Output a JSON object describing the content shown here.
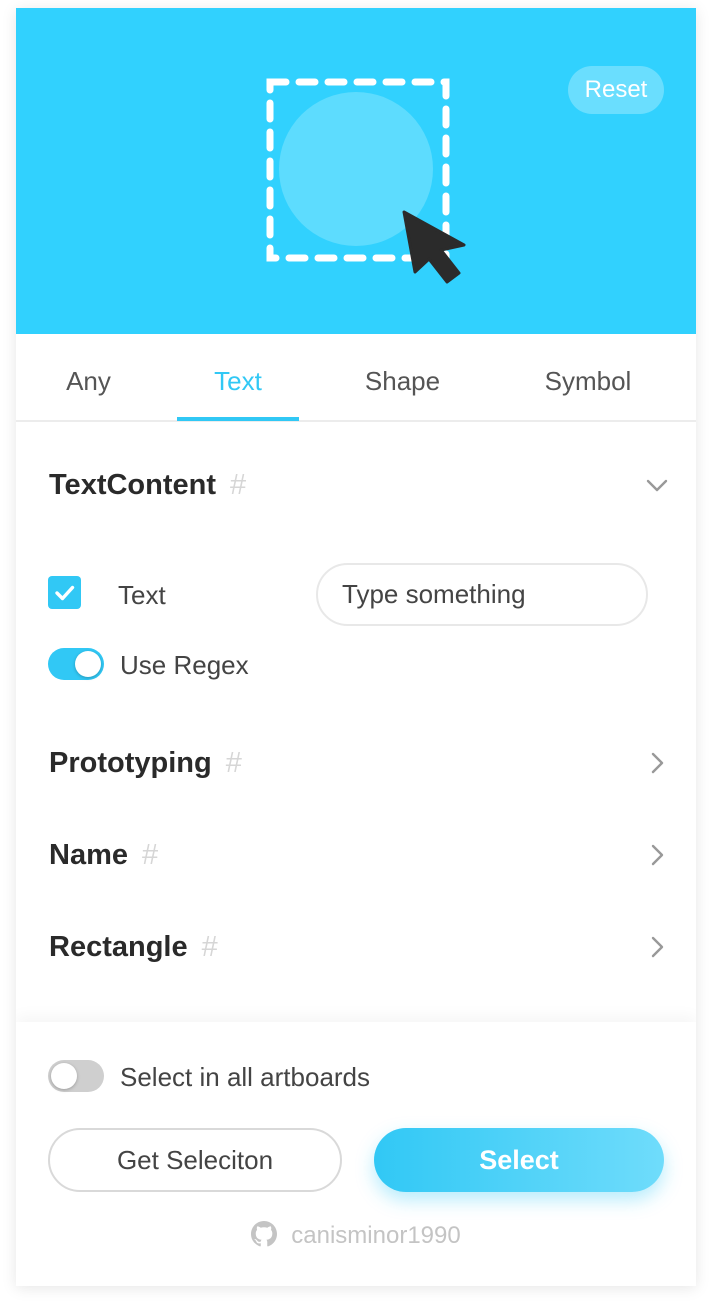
{
  "header": {
    "illustration": "select-shape-illustration",
    "reset_label": "Reset",
    "background_color": "#31d1fe"
  },
  "tabs": [
    {
      "label": "Any",
      "active": false
    },
    {
      "label": "Text",
      "active": true
    },
    {
      "label": "Shape",
      "active": false
    },
    {
      "label": "Symbol",
      "active": false
    }
  ],
  "sections": {
    "text_content": {
      "title": "TextContent",
      "hash": "#",
      "expanded": true,
      "text_option": {
        "label": "Text",
        "checked": true
      },
      "text_input": {
        "placeholder": "Type something",
        "value": ""
      },
      "regex": {
        "label": "Use Regex",
        "on": true
      }
    },
    "prototyping": {
      "title": "Prototyping",
      "hash": "#"
    },
    "name": {
      "title": "Name",
      "hash": "#"
    },
    "rectangle": {
      "title": "Rectangle",
      "hash": "#"
    }
  },
  "footer": {
    "all_artboards": {
      "label": "Select in all artboards",
      "on": false
    },
    "get_selection_label": "Get Seleciton",
    "select_label": "Select",
    "credit": {
      "icon": "github-icon",
      "text": "canisminor1990"
    }
  },
  "colors": {
    "accent": "#31c8f5",
    "muted": "#cfcfcf"
  }
}
